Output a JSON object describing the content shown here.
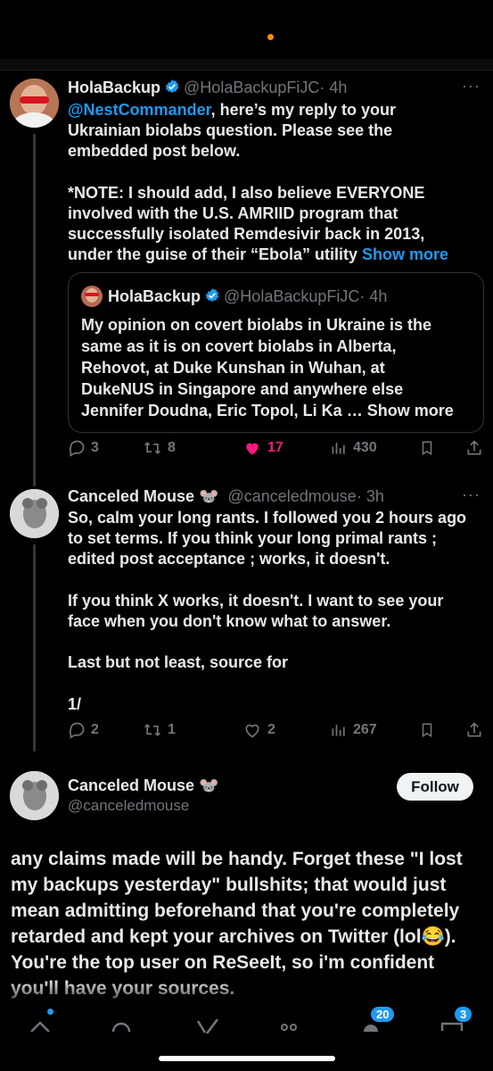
{
  "tweets": [
    {
      "name": "HolaBackup",
      "handle": "@HolaBackupFiJC",
      "time": "· 4h",
      "mention": "@NestCommander",
      "line1_rest": ", here’s my reply to your",
      "lines": [
        "Ukrainian biolabs question. Please see the",
        "embedded post below.",
        "",
        "*NOTE: I should add, I also believe EVERYONE",
        "involved with the U.S. AMRIID program that",
        "successfully isolated Remdesivir back in 2013,"
      ],
      "last_line": "under the guise of their “Ebola” utility",
      "show_more": "Show more",
      "quote": {
        "name": "HolaBackup",
        "handle": "@HolaBackupFiJC",
        "time": "· 4h",
        "lines": [
          "My opinion on covert biolabs in Ukraine is the",
          "same as it is on covert biolabs in Alberta,",
          "Rehovot, at Duke Kunshan in Wuhan, at",
          "DukeNUS in Singapore and anywhere else"
        ],
        "last_line": "Jennifer Doudna, Eric Topol, Li Ka …",
        "show_more": "Show more"
      },
      "replies": "3",
      "retweets": "8",
      "likes": "17",
      "views": "430"
    },
    {
      "name": "Canceled Mouse 🐭",
      "handle": "@canceledmouse",
      "time": "· 3h",
      "lines": [
        "So, calm your long rants. I followed you 2 hours ago",
        "to set terms. If you think your long primal rants ;",
        "edited post acceptance ; works, it doesn't.",
        "",
        "If you think X works, it doesn't. I want to see your",
        "face when you don't know what to answer.",
        "",
        "Last but not least, source for",
        "",
        "1/"
      ],
      "replies": "2",
      "retweets": "1",
      "likes": "2",
      "views": "267"
    }
  ],
  "main_post": {
    "name": "Canceled Mouse 🐭",
    "handle": "@canceledmouse",
    "follow_label": "Follow",
    "text": "any claims made will be handy. Forget these \"I lost my backups yesterday\" bullshits; that would just mean admitting beforehand that you're completely retarded and kept your archives on Twitter (lol😂). You're the top user on ReSeeIt, so i'm confident you'll have your sources."
  },
  "nav": {
    "notifications_badge": "20",
    "messages_badge": "3"
  },
  "colors": {
    "background": "#000000",
    "accent": "#1d9bf0",
    "like": "#f91880",
    "muted": "#71767b"
  }
}
